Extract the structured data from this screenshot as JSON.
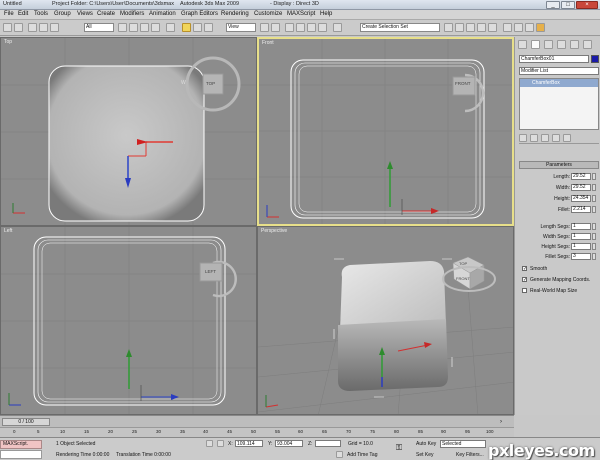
{
  "window": {
    "title_left": "Untitled",
    "project": "Project Folder: C:\\Users\\User\\Documents\\3dsmax",
    "app": "Autodesk 3ds Max 2009",
    "display": "- Display : Direct 3D",
    "min": "_",
    "max": "□",
    "close": "×"
  },
  "menu": [
    "File",
    "Edit",
    "Tools",
    "Group",
    "Views",
    "Create",
    "Modifiers",
    "Animation",
    "Graph Editors",
    "Rendering",
    "Customize",
    "MAXScript",
    "Help"
  ],
  "toolbar": {
    "filter": "All",
    "view": "View",
    "selection_set": "Create Selection Set"
  },
  "viewports": {
    "top": {
      "label": "Top",
      "cube": "TOP",
      "axis": "W"
    },
    "front": {
      "label": "Front",
      "cube": "FRONT"
    },
    "left": {
      "label": "Left",
      "cube": "LEFT"
    },
    "perspective": {
      "label": "Perspective",
      "cube_top": "TOP",
      "cube_front": "FRONT"
    }
  },
  "command_panel": {
    "object_name": "ChamferBox01",
    "modifier_list": "Modifier List",
    "stack_item": "ChamferBox",
    "rollout": "Parameters",
    "params": [
      {
        "label": "Length:",
        "value": "29.52"
      },
      {
        "label": "Width:",
        "value": "29.52"
      },
      {
        "label": "Height:",
        "value": "24.354"
      },
      {
        "label": "Fillet:",
        "value": "2.214"
      },
      {
        "label": "Length Segs:",
        "value": "1"
      },
      {
        "label": "Width Segs:",
        "value": "1"
      },
      {
        "label": "Height Segs:",
        "value": "1"
      },
      {
        "label": "Fillet Segs:",
        "value": "3"
      }
    ],
    "checks": [
      {
        "label": "Smooth",
        "checked": true
      },
      {
        "label": "Generate Mapping Coords.",
        "checked": true
      },
      {
        "label": "Real-World Map Size",
        "checked": false
      }
    ],
    "colors": {
      "object": "#1a1aa8"
    }
  },
  "timeline": {
    "frame": "0 / 100",
    "ticks": [
      "0",
      "5",
      "10",
      "15",
      "20",
      "25",
      "30",
      "35",
      "40",
      "45",
      "50",
      "55",
      "60",
      "65",
      "70",
      "75",
      "80",
      "85",
      "90",
      "95",
      "100"
    ]
  },
  "status": {
    "maxscript": "MAXScript.",
    "objects": "1 Object Selected",
    "rendering_time": "Rendering Time  0:00:00",
    "translation_time": "Translation Time  0:00:00",
    "x_label": "X:",
    "x": "109.114",
    "y_label": "Y:",
    "y": "93.004",
    "z_label": "Z:",
    "grid": "Grid = 10.0",
    "add_time_tag": "Add Time Tag",
    "auto_key": "Auto Key",
    "set_key": "Set Key",
    "selected": "Selected",
    "key_filters": "Key Filters..."
  },
  "watermark": "pxleyes.com"
}
